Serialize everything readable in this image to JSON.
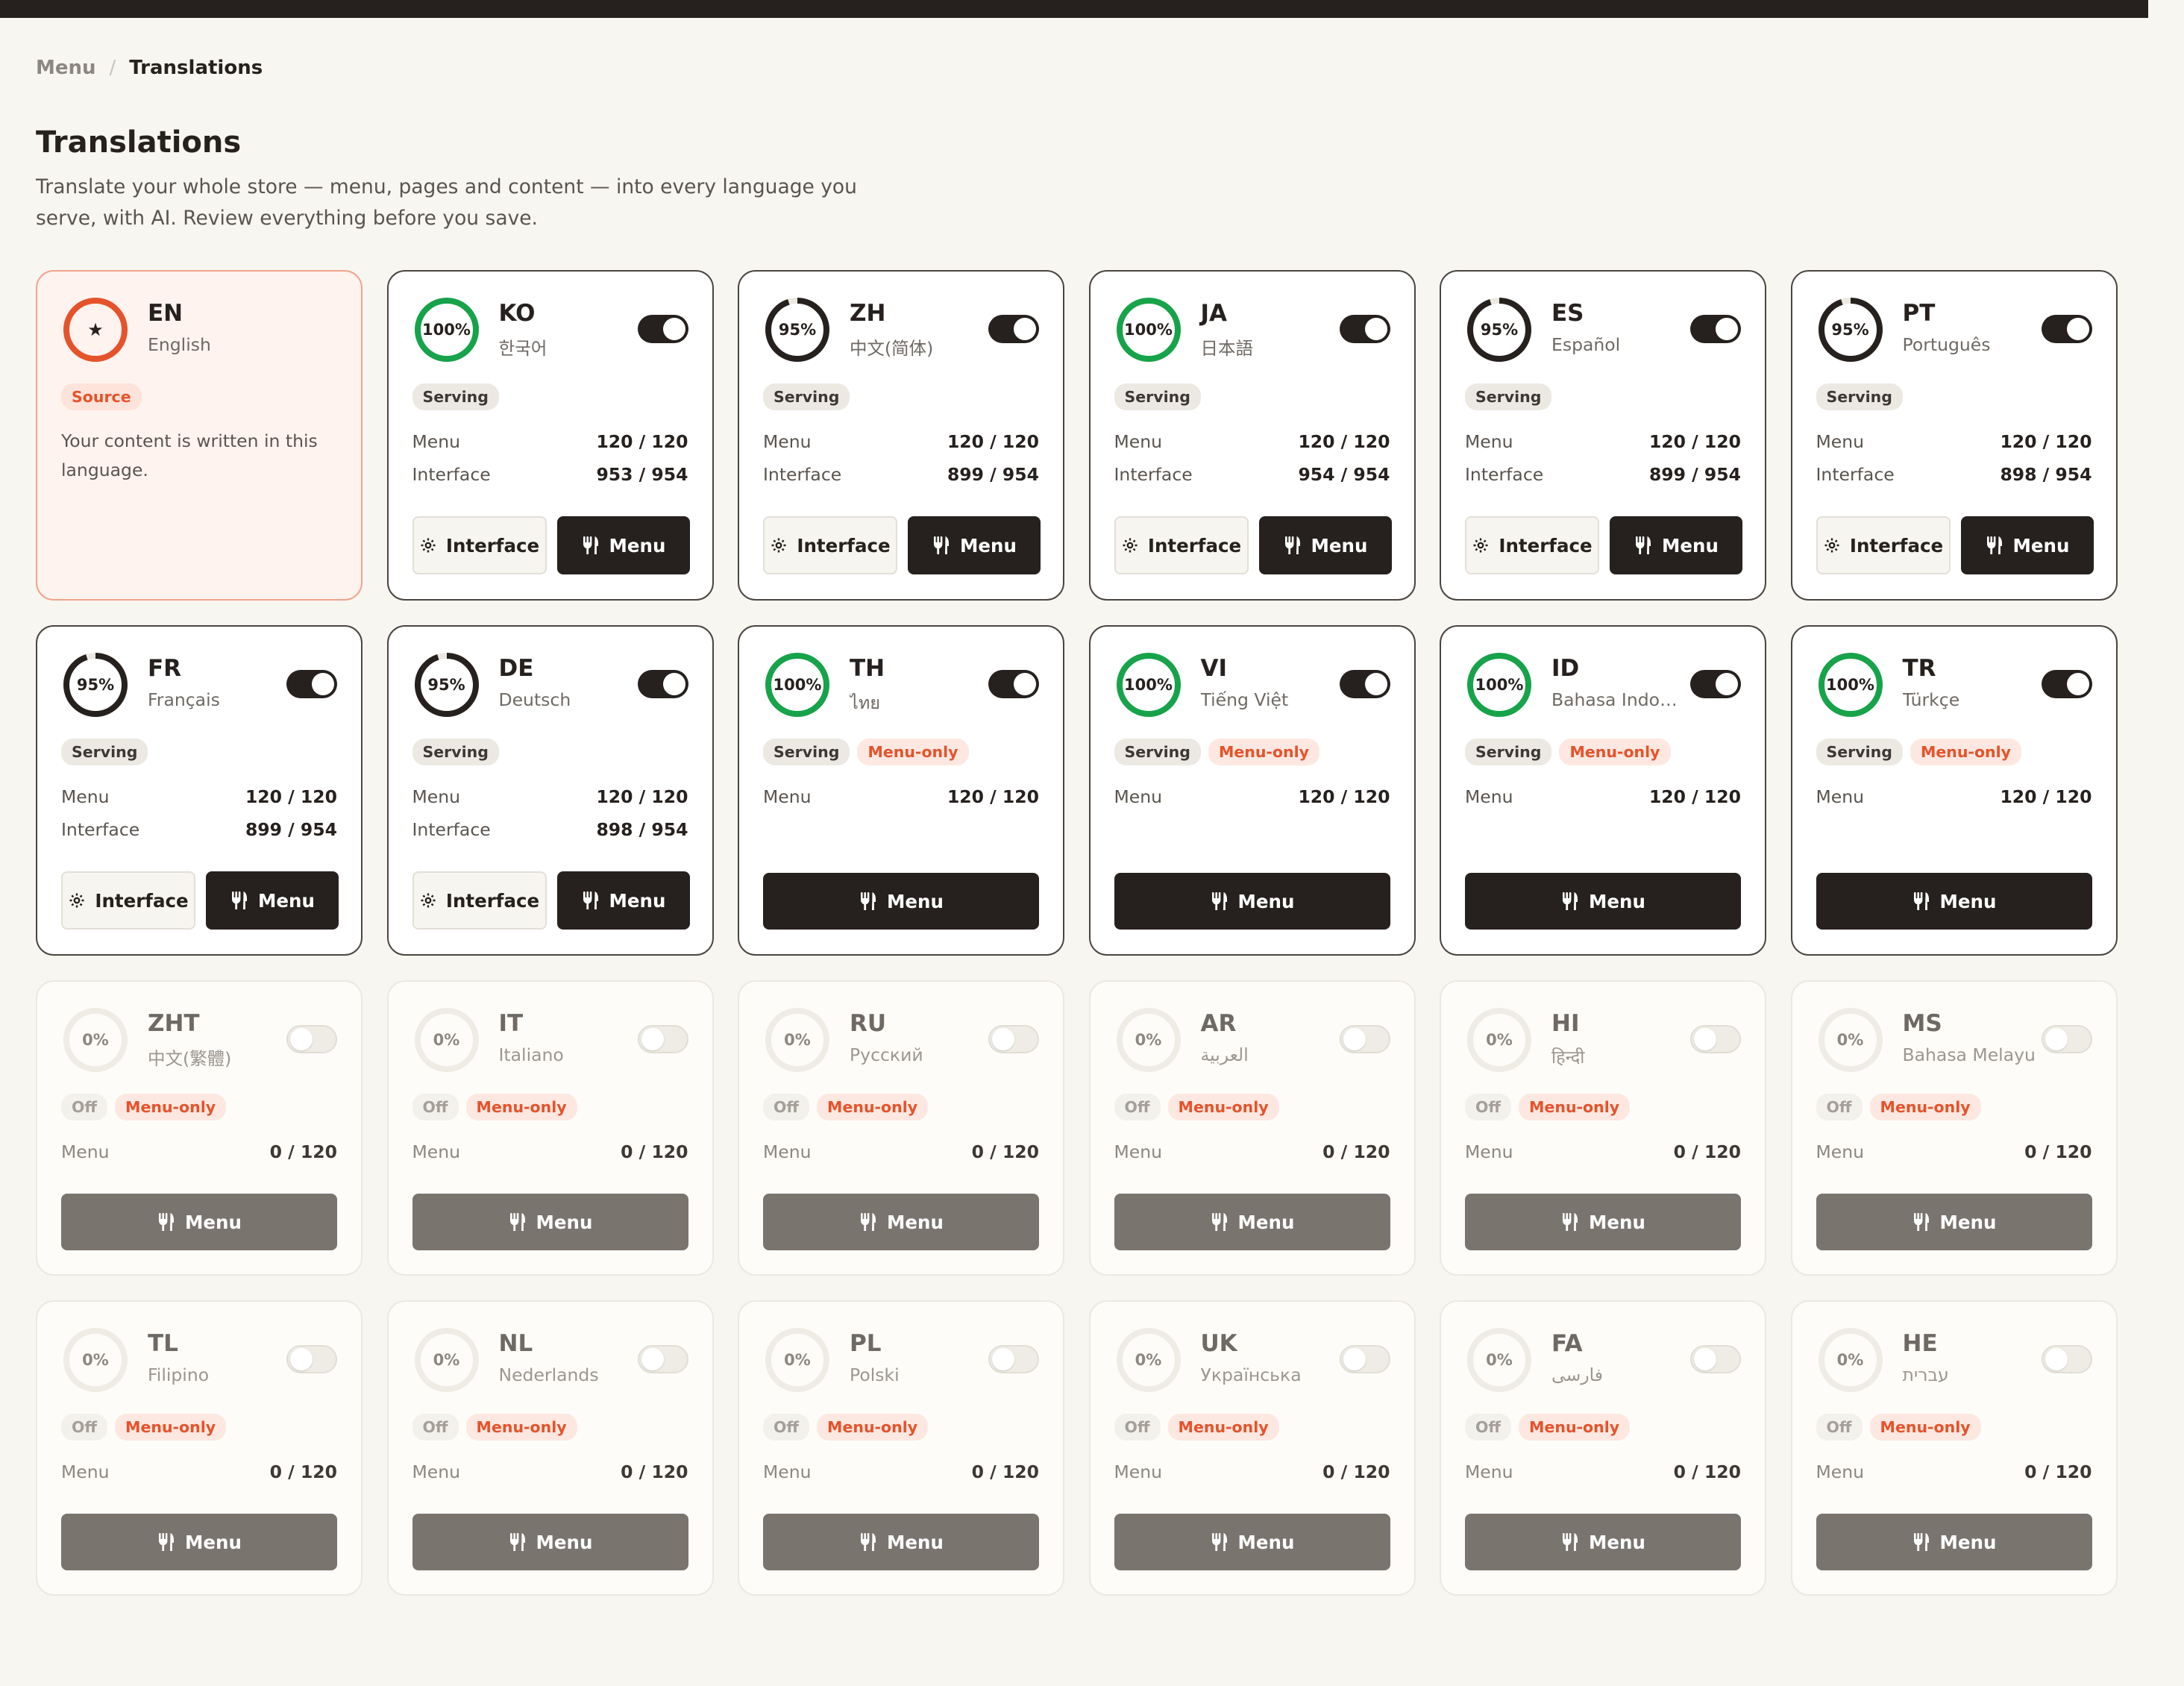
{
  "breadcrumb": {
    "parent": "Menu",
    "separator": "/",
    "current": "Translations"
  },
  "page": {
    "title": "Translations",
    "description": "Translate your whole store — menu, pages and content — into every language you serve, with AI. Review everything before you save."
  },
  "colors": {
    "accent": "#e5532b",
    "complete": "#17a34a",
    "dark": "#26211e",
    "muted": "#7a746f"
  },
  "labels": {
    "menu": "Menu",
    "interface": "Interface"
  },
  "languages": [
    {
      "code": "EN",
      "native": "English",
      "source": true,
      "badge": "Source",
      "description": "Your content is written in this language."
    },
    {
      "code": "KO",
      "native": "한국어",
      "progress": "100%",
      "status": "Serving",
      "enabled": true,
      "menu": "120 / 120",
      "interface": "953 / 954"
    },
    {
      "code": "ZH",
      "native": "中文(简体)",
      "progress": "95%",
      "status": "Serving",
      "enabled": true,
      "menu": "120 / 120",
      "interface": "899 / 954"
    },
    {
      "code": "JA",
      "native": "日本語",
      "progress": "100%",
      "status": "Serving",
      "enabled": true,
      "menu": "120 / 120",
      "interface": "954 / 954"
    },
    {
      "code": "ES",
      "native": "Español",
      "progress": "95%",
      "status": "Serving",
      "enabled": true,
      "menu": "120 / 120",
      "interface": "899 / 954"
    },
    {
      "code": "PT",
      "native": "Português",
      "progress": "95%",
      "status": "Serving",
      "enabled": true,
      "menu": "120 / 120",
      "interface": "898 / 954"
    },
    {
      "code": "FR",
      "native": "Français",
      "progress": "95%",
      "status": "Serving",
      "enabled": true,
      "menu": "120 / 120",
      "interface": "899 / 954"
    },
    {
      "code": "DE",
      "native": "Deutsch",
      "progress": "95%",
      "status": "Serving",
      "enabled": true,
      "menu": "120 / 120",
      "interface": "898 / 954"
    },
    {
      "code": "TH",
      "native": "ไทย",
      "progress": "100%",
      "status": "Serving",
      "menu_only": "Menu-only",
      "enabled": true,
      "menu": "120 / 120"
    },
    {
      "code": "VI",
      "native": "Tiếng Việt",
      "progress": "100%",
      "status": "Serving",
      "menu_only": "Menu-only",
      "enabled": true,
      "menu": "120 / 120"
    },
    {
      "code": "ID",
      "native": "Bahasa Indonesia",
      "progress": "100%",
      "status": "Serving",
      "menu_only": "Menu-only",
      "enabled": true,
      "menu": "120 / 120"
    },
    {
      "code": "TR",
      "native": "Türkçe",
      "progress": "100%",
      "status": "Serving",
      "menu_only": "Menu-only",
      "enabled": true,
      "menu": "120 / 120"
    },
    {
      "code": "ZHT",
      "native": "中文(繁體)",
      "progress": "0%",
      "status": "Off",
      "menu_only": "Menu-only",
      "enabled": false,
      "menu": "0 / 120"
    },
    {
      "code": "IT",
      "native": "Italiano",
      "progress": "0%",
      "status": "Off",
      "menu_only": "Menu-only",
      "enabled": false,
      "menu": "0 / 120"
    },
    {
      "code": "RU",
      "native": "Русский",
      "progress": "0%",
      "status": "Off",
      "menu_only": "Menu-only",
      "enabled": false,
      "menu": "0 / 120"
    },
    {
      "code": "AR",
      "native": "العربية",
      "progress": "0%",
      "status": "Off",
      "menu_only": "Menu-only",
      "enabled": false,
      "menu": "0 / 120"
    },
    {
      "code": "HI",
      "native": "हिन्दी",
      "progress": "0%",
      "status": "Off",
      "menu_only": "Menu-only",
      "enabled": false,
      "menu": "0 / 120"
    },
    {
      "code": "MS",
      "native": "Bahasa Melayu",
      "progress": "0%",
      "status": "Off",
      "menu_only": "Menu-only",
      "enabled": false,
      "menu": "0 / 120"
    },
    {
      "code": "TL",
      "native": "Filipino",
      "progress": "0%",
      "status": "Off",
      "menu_only": "Menu-only",
      "enabled": false,
      "menu": "0 / 120"
    },
    {
      "code": "NL",
      "native": "Nederlands",
      "progress": "0%",
      "status": "Off",
      "menu_only": "Menu-only",
      "enabled": false,
      "menu": "0 / 120"
    },
    {
      "code": "PL",
      "native": "Polski",
      "progress": "0%",
      "status": "Off",
      "menu_only": "Menu-only",
      "enabled": false,
      "menu": "0 / 120"
    },
    {
      "code": "UK",
      "native": "Українська",
      "progress": "0%",
      "status": "Off",
      "menu_only": "Menu-only",
      "enabled": false,
      "menu": "0 / 120"
    },
    {
      "code": "FA",
      "native": "فارسی",
      "progress": "0%",
      "status": "Off",
      "menu_only": "Menu-only",
      "enabled": false,
      "menu": "0 / 120"
    },
    {
      "code": "HE",
      "native": "עברית",
      "progress": "0%",
      "status": "Off",
      "menu_only": "Menu-only",
      "enabled": false,
      "menu": "0 / 120"
    }
  ]
}
